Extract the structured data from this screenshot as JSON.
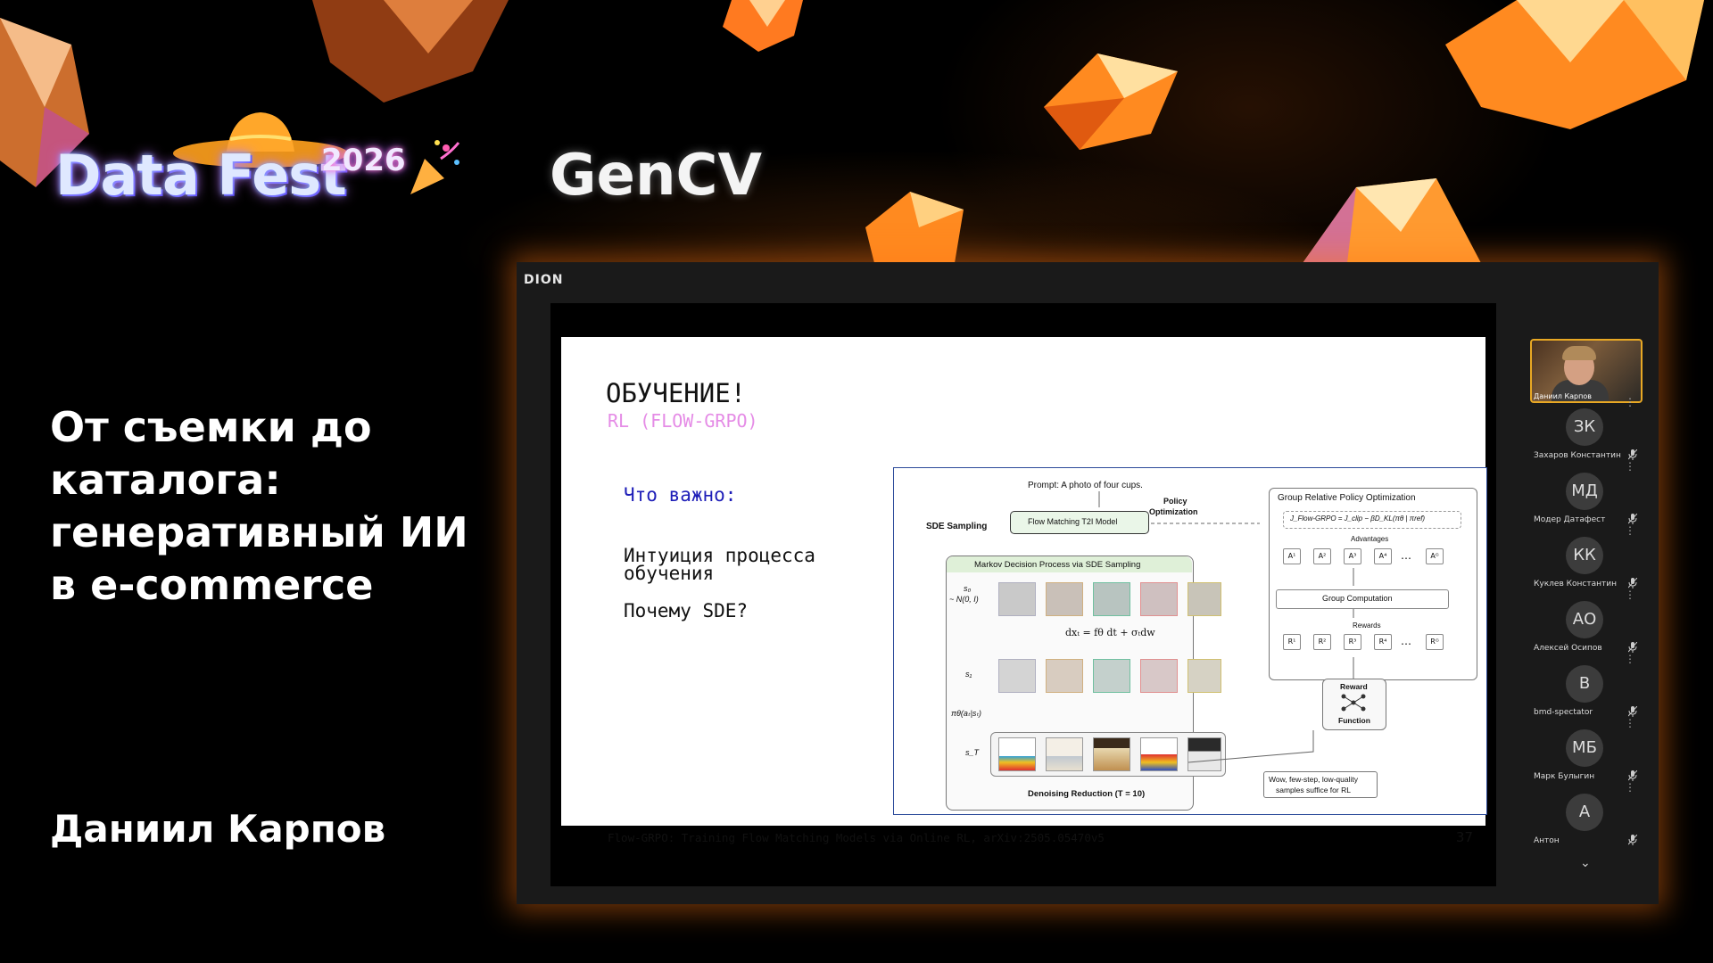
{
  "event": {
    "logo_text": "Data Fest",
    "logo_year": "2026",
    "track": "GenCV",
    "talk_title": "От съемки до каталога: генеративный ИИ в e-commerce",
    "speaker": "Даниил Карпов"
  },
  "conference_app": {
    "brand": "DION"
  },
  "slide": {
    "title": "ОБУЧЕНИЕ!",
    "subtitle": "RL (FLOW-GRPO)",
    "important_label": "Что важно:",
    "bullet_1": "Интуиция процесса обучения",
    "bullet_2": "Почему SDE?",
    "citation": "Flow-GRPO: Training Flow Matching Models via Online RL, arXiv:2505.05470v5",
    "page_number": "37",
    "figure": {
      "prompt": "Prompt: A photo of four cups.",
      "sde_sampling": "SDE Sampling",
      "model": "Flow Matching T2I Model",
      "policy_optimization_1": "Policy",
      "policy_optimization_2": "Optimization",
      "mdp_title": "Markov Decision Process via SDE Sampling",
      "s0": "s₀",
      "s0_dist": "~ N(0, I)",
      "equation": "dxₜ = fθ dt + σₜdw",
      "s1": "s₁",
      "policy": "πθ(aₜ|sₜ)",
      "sT": "s_T",
      "denoising": "Denoising Reduction (T = 10)",
      "grpo_title": "Group Relative Policy Optimization",
      "objective": "J_Flow-GRPO = J_clip − βD_KL(πθ | πref)",
      "advantages": "Advantages",
      "adv_labels": [
        "A¹",
        "A²",
        "A³",
        "A⁴",
        "…",
        "Aᴳ"
      ],
      "group_computation": "Group Computation",
      "rewards": "Rewards",
      "reward_labels": [
        "R¹",
        "R²",
        "R³",
        "R⁴",
        "…",
        "Rᴳ"
      ],
      "reward_fn_1": "Reward",
      "reward_fn_2": "Function",
      "note_1": "Wow, few-step, low-quality",
      "note_2": "samples suffice for RL"
    }
  },
  "participants": {
    "self_name": "Даниил Карпов",
    "list": [
      {
        "initials": "ЗК",
        "name": "Захаров Константин"
      },
      {
        "initials": "МД",
        "name": "Модер Датафест"
      },
      {
        "initials": "КК",
        "name": "Куклев Константин"
      },
      {
        "initials": "АО",
        "name": "Алексей Осипов"
      },
      {
        "initials": "В",
        "name": "bmd-spectator"
      },
      {
        "initials": "МБ",
        "name": "Марк Булыгин"
      },
      {
        "initials": "А",
        "name": "Антон"
      }
    ]
  },
  "colors": {
    "accent_glow": "#ff7814",
    "slide_subtitle": "#e58ce6",
    "slide_important": "#1e1eb8",
    "self_border": "#e8a824"
  }
}
